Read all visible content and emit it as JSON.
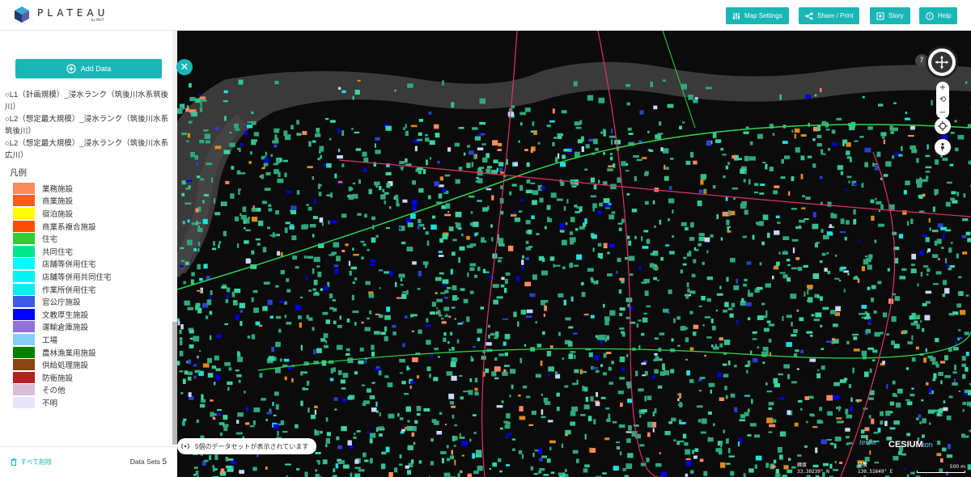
{
  "brand": {
    "name": "PLATEAU",
    "sub": "by MLIT"
  },
  "header": {
    "buttons": [
      {
        "label": "Map Settings",
        "icon": "sliders-icon"
      },
      {
        "label": "Share / Print",
        "icon": "share-icon"
      },
      {
        "label": "Story",
        "icon": "story-icon"
      },
      {
        "label": "Help",
        "icon": "help-icon"
      }
    ]
  },
  "workbench": {
    "add_data_label": "Add Data",
    "layers": [
      "○L1（計画規模）_浸水ランク（筑後川水系筑後川）",
      "○L2（想定最大規模）_浸水ランク（筑後川水系筑後川）",
      "○L2（想定最大規模）_浸水ランク（筑後川水系広川）"
    ],
    "legend_title": "凡例",
    "legend": [
      {
        "label": "業務施設",
        "color": "#fb8a5e"
      },
      {
        "label": "商業施設",
        "color": "#ff5a1a"
      },
      {
        "label": "宿泊施設",
        "color": "#ffff00"
      },
      {
        "label": "商業系複合施設",
        "color": "#ff4d00"
      },
      {
        "label": "住宅",
        "color": "#33cc33"
      },
      {
        "label": "共同住宅",
        "color": "#00e68c"
      },
      {
        "label": "店舗等併用住宅",
        "color": "#00ffff"
      },
      {
        "label": "店舗等併用共同住宅",
        "color": "#00f5f5"
      },
      {
        "label": "作業所併用住宅",
        "color": "#00f0f0"
      },
      {
        "label": "官公庁施設",
        "color": "#3d5ce6"
      },
      {
        "label": "文教厚生施設",
        "color": "#0000ff"
      },
      {
        "label": "運輸倉庫施設",
        "color": "#9370db"
      },
      {
        "label": "工場",
        "color": "#87cefa"
      },
      {
        "label": "農林漁業用施設",
        "color": "#008000"
      },
      {
        "label": "供給処理施設",
        "color": "#8b4513"
      },
      {
        "label": "防衛施設",
        "color": "#b22222"
      },
      {
        "label": "その他",
        "color": "#d8bfd8"
      },
      {
        "label": "不明",
        "color": "#e6e6fa"
      }
    ],
    "delete_all_label": "すべて削除",
    "datasets_label": "Data Sets",
    "datasets_count": "5"
  },
  "map": {
    "status_text": "5個のデータセットが表示されています",
    "terria_label": "terria",
    "cesium_label": "CESIUM",
    "cesium_suffix": "ion",
    "lat_label": "緯度",
    "lat_value": "33.30239° N",
    "lon_label": "経度",
    "lon_value": "130.51649° E",
    "scale_label": "500 m"
  }
}
